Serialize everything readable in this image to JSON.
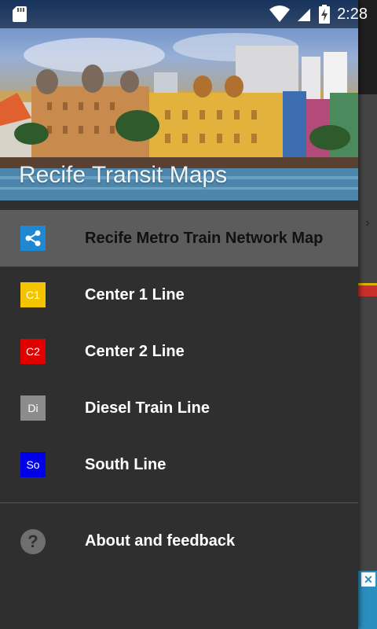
{
  "status_bar": {
    "time": "2:28"
  },
  "drawer": {
    "header_title": "Recife Transit Maps",
    "items": [
      {
        "label": "Recife Metro Train Network Map",
        "icon": "share-network-icon",
        "icon_color": "#1e88d2",
        "selected": true
      },
      {
        "label": "Center 1 Line",
        "badge": "C1",
        "badge_color": "#f5c400"
      },
      {
        "label": "Center 2 Line",
        "badge": "C2",
        "badge_color": "#e00000"
      },
      {
        "label": "Diesel Train Line",
        "badge": "Di",
        "badge_color": "#8c8c8c"
      },
      {
        "label": "South Line",
        "badge": "So",
        "badge_color": "#0000e6"
      }
    ],
    "footer": {
      "label": "About and feedback",
      "icon": "help-icon"
    }
  }
}
